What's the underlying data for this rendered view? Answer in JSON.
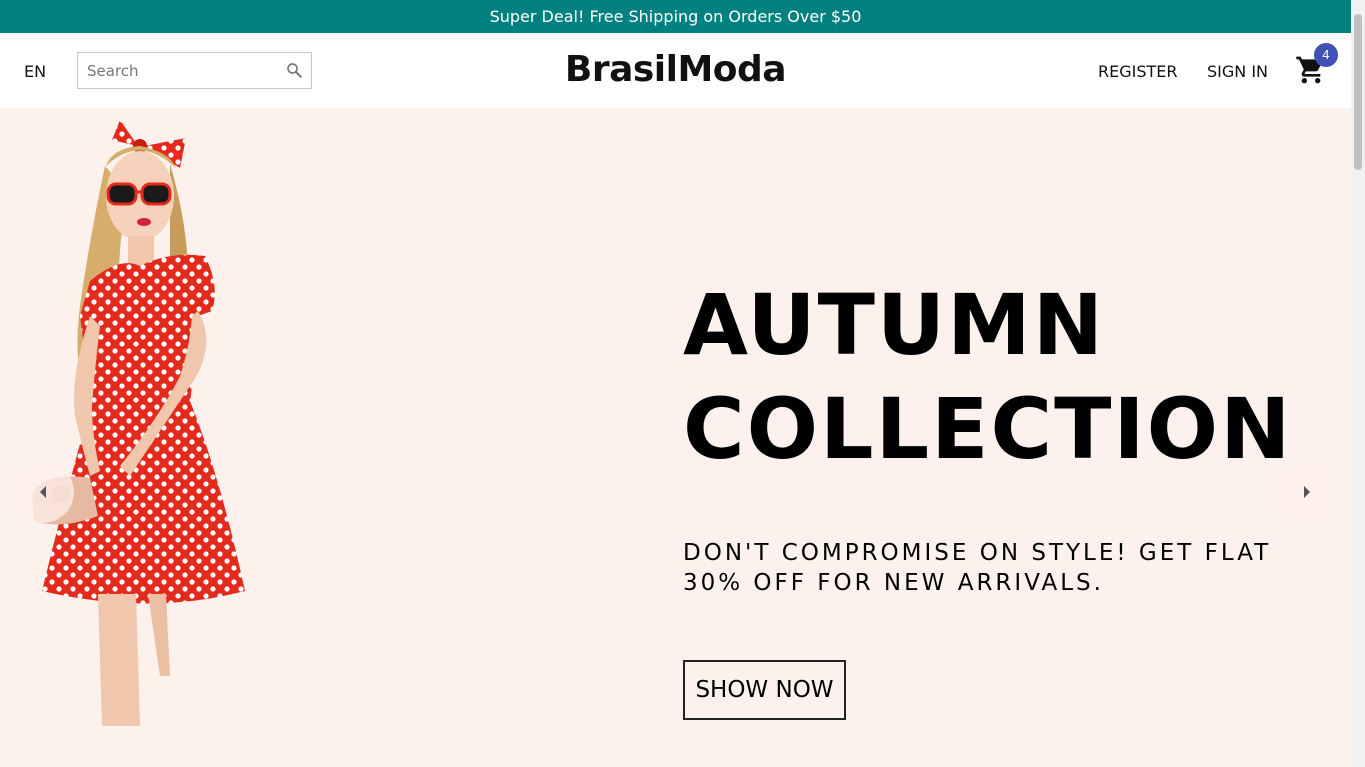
{
  "announcement": {
    "text": "Super Deal! Free Shipping on Orders Over $50"
  },
  "navbar": {
    "language": "EN",
    "search": {
      "placeholder": "Search",
      "value": ""
    },
    "logo": "BrasilModa",
    "register_label": "REGISTER",
    "signin_label": "SIGN IN",
    "cart_count": "4"
  },
  "slide": {
    "title_line1": "AUTUMN",
    "title_line2": "COLLECTION",
    "description_line1": "DON'T COMPROMISE ON STYLE! GET FLAT",
    "description_line2": "30% OFF FOR NEW ARRIVALS.",
    "button_label": "SHOW NOW"
  },
  "colors": {
    "announcement_bg": "#008080",
    "slide_bg": "#fcf1ed",
    "badge_bg": "#3f51b5"
  },
  "icons": {
    "search": "search-icon",
    "cart": "cart-icon",
    "prev": "arrow-left-icon",
    "next": "arrow-right-icon"
  }
}
